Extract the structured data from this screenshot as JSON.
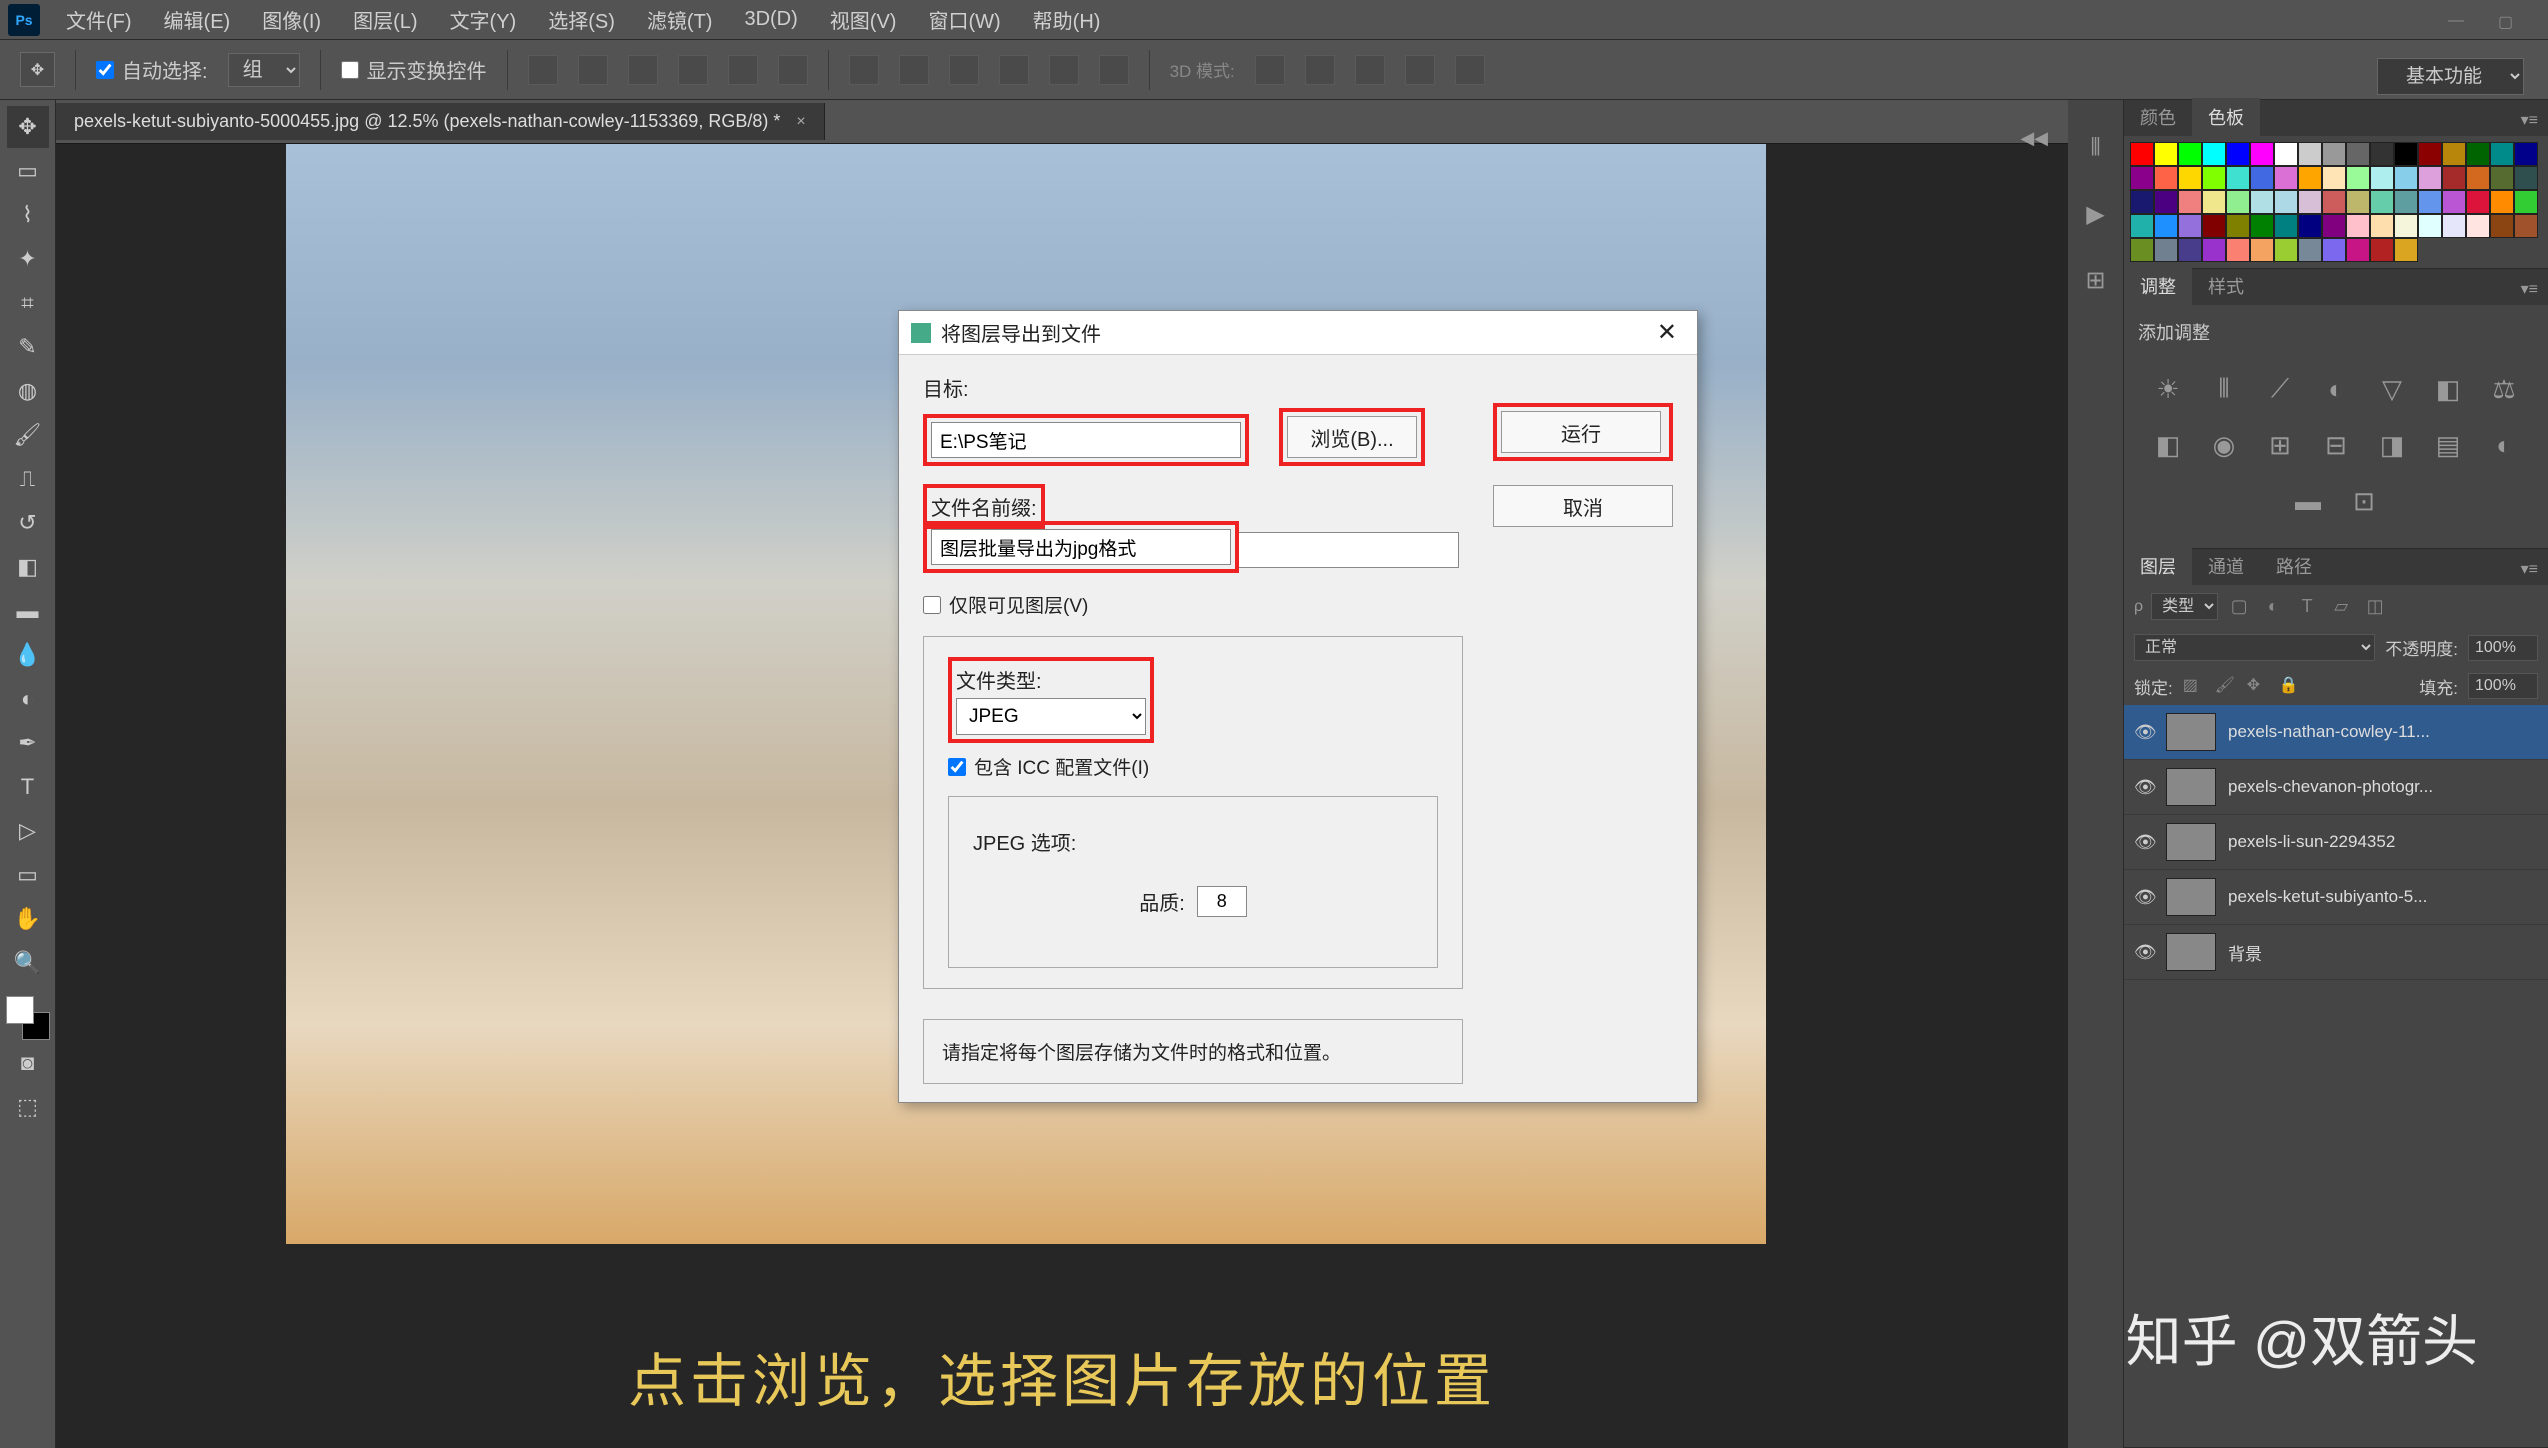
{
  "menubar": {
    "items": [
      "文件(F)",
      "编辑(E)",
      "图像(I)",
      "图层(L)",
      "文字(Y)",
      "选择(S)",
      "滤镜(T)",
      "3D(D)",
      "视图(V)",
      "窗口(W)",
      "帮助(H)"
    ]
  },
  "options": {
    "auto_select": "自动选择:",
    "group": "组",
    "show_transform": "显示变换控件",
    "mode3d": "3D 模式:"
  },
  "workspace": "基本功能",
  "tab": {
    "title": "pexels-ketut-subiyanto-5000455.jpg @ 12.5% (pexels-nathan-cowley-1153369, RGB/8) *"
  },
  "caption": "点击浏览，选择图片存放的位置",
  "dialog": {
    "title": "将图层导出到文件",
    "dest_label": "目标:",
    "dest_value": "E:\\PS笔记",
    "browse": "浏览(B)...",
    "run": "运行",
    "cancel": "取消",
    "prefix_label": "文件名前缀:",
    "prefix_value": "图层批量导出为jpg格式",
    "visible_only": "仅限可见图层(V)",
    "file_type_label": "文件类型:",
    "file_type_value": "JPEG",
    "include_icc": "包含 ICC 配置文件(I)",
    "jpeg_options": "JPEG 选项:",
    "quality_label": "品质:",
    "quality_value": "8",
    "hint": "请指定将每个图层存储为文件时的格式和位置。"
  },
  "panels": {
    "color_tab": "颜色",
    "swatch_tab": "色板",
    "adjust_tab": "调整",
    "style_tab": "样式",
    "add_adjust": "添加调整",
    "layers_tab": "图层",
    "channels_tab": "通道",
    "paths_tab": "路径",
    "kind": "类型",
    "blend": "正常",
    "opacity_lbl": "不透明度:",
    "opacity": "100%",
    "lock_lbl": "锁定:",
    "fill_lbl": "填充:",
    "fill": "100%",
    "layers": [
      {
        "name": "pexels-nathan-cowley-11...",
        "sel": true
      },
      {
        "name": "pexels-chevanon-photogr..."
      },
      {
        "name": "pexels-li-sun-2294352"
      },
      {
        "name": "pexels-ketut-subiyanto-5..."
      },
      {
        "name": "背景"
      }
    ]
  },
  "watermark": "知乎 @双箭头",
  "swatches": [
    "#ff0000",
    "#ffff00",
    "#00ff00",
    "#00ffff",
    "#0000ff",
    "#ff00ff",
    "#ffffff",
    "#cccccc",
    "#999999",
    "#666666",
    "#333333",
    "#000000",
    "#8b0000",
    "#b8860b",
    "#006400",
    "#008b8b",
    "#00008b",
    "#8b008b",
    "#ff6347",
    "#ffd700",
    "#7fff00",
    "#40e0d0",
    "#4169e1",
    "#da70d6",
    "#ffa500",
    "#ffe4b5",
    "#98fb98",
    "#afeeee",
    "#87ceeb",
    "#dda0dd",
    "#a52a2a",
    "#d2691e",
    "#556b2f",
    "#2f4f4f",
    "#191970",
    "#4b0082",
    "#f08080",
    "#f0e68c",
    "#90ee90",
    "#b0e0e6",
    "#add8e6",
    "#d8bfd8",
    "#cd5c5c",
    "#bdb76b",
    "#66cdaa",
    "#5f9ea0",
    "#6495ed",
    "#ba55d3",
    "#dc143c",
    "#ff8c00",
    "#32cd32",
    "#20b2aa",
    "#1e90ff",
    "#9370db",
    "#800000",
    "#808000",
    "#008000",
    "#008080",
    "#000080",
    "#800080",
    "#ffc0cb",
    "#ffdead",
    "#f5f5dc",
    "#e0ffff",
    "#e6e6fa",
    "#ffe4e1",
    "#8b4513",
    "#a0522d",
    "#6b8e23",
    "#708090",
    "#483d8b",
    "#9932cc",
    "#fa8072",
    "#f4a460",
    "#9acd32",
    "#778899",
    "#7b68ee",
    "#c71585",
    "#b22222",
    "#daa520"
  ]
}
